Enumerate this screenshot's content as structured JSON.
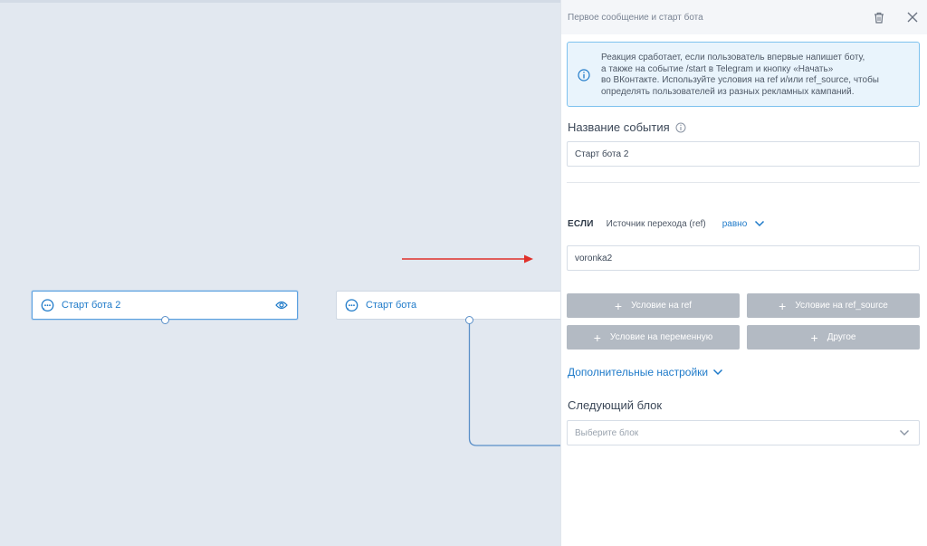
{
  "canvas": {
    "nodes": [
      {
        "title": "Старт бота 2",
        "selected": true,
        "show_eye": true
      },
      {
        "title": "Старт бота",
        "selected": false,
        "show_eye": false
      }
    ]
  },
  "panel": {
    "title": "Первое сообщение и старт бота",
    "info_lines": [
      "Реакция сработает, если пользователь впервые напишет боту,",
      "а также на событие /start в Telegram и кнопку «Начать»",
      "во ВКонтакте. Используйте условия на ref и/или ref_source, чтобы",
      "определять пользователей из разных рекламных кампаний."
    ],
    "event_name_label": "Название события",
    "event_name_value": "Старт бота 2",
    "condition": {
      "if_keyword": "ЕСЛИ",
      "source": "Источник перехода (ref)",
      "operator": "равно",
      "value": "voronka2"
    },
    "buttons": {
      "ref": "Условие на ref",
      "ref_source": "Условие на ref_source",
      "variable": "Условие на переменную",
      "other": "Другое"
    },
    "advanced_settings": "Дополнительные настройки",
    "next_block_label": "Следующий блок",
    "next_block_placeholder": "Выберите блок"
  },
  "colors": {
    "accent": "#1e7ac9",
    "canvas_bg": "#e2e8f0",
    "info_bg": "#e9f4fc",
    "info_border": "#7ec2ee",
    "button_gray": "#b3bac3",
    "annotation_arrow": "#e0302a"
  },
  "icons": {
    "node": "chat-bubble-icon",
    "preview": "eye-icon",
    "delete": "trash-icon",
    "close": "close-icon",
    "info": "info-icon",
    "help": "question-icon",
    "dropdown": "chevron-down-icon",
    "add": "plus-icon"
  }
}
